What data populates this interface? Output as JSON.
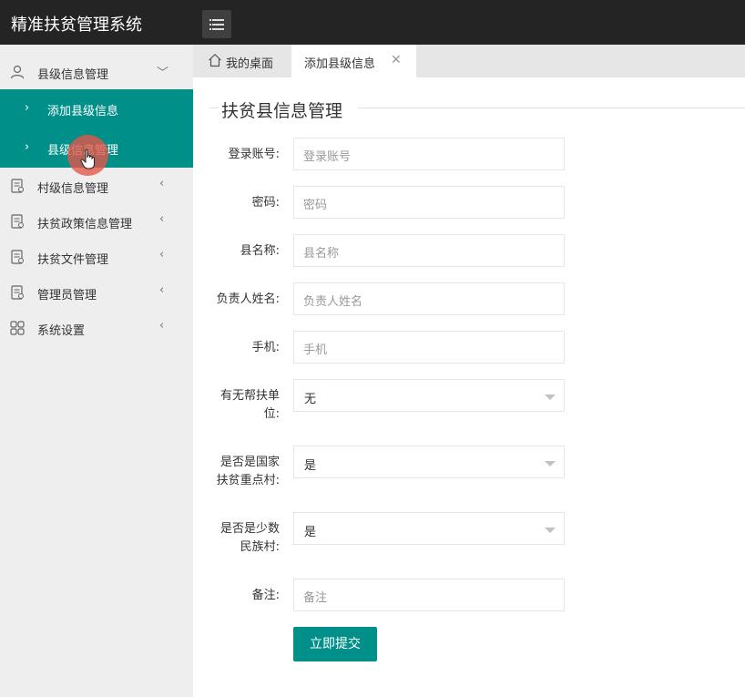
{
  "app": {
    "title": "精准扶贫管理系统"
  },
  "header": {
    "menu_icon": "menu-icon"
  },
  "sidebar": {
    "groups": [
      {
        "label": "县级信息管理",
        "icon": "user-icon",
        "expanded": true
      },
      {
        "label": "村级信息管理",
        "icon": "document-icon"
      },
      {
        "label": "扶贫政策信息管理",
        "icon": "document-icon"
      },
      {
        "label": "扶贫文件管理",
        "icon": "document-icon"
      },
      {
        "label": "管理员管理",
        "icon": "document-icon"
      },
      {
        "label": "系统设置",
        "icon": "grid-icon"
      }
    ],
    "sub_items": [
      {
        "label": "添加县级信息"
      },
      {
        "label": "县级信息管理"
      }
    ],
    "accent": "#009089"
  },
  "tabs": [
    {
      "label": "我的桌面",
      "icon": "home-icon"
    },
    {
      "label": "添加县级信息",
      "active": true
    }
  ],
  "form": {
    "legend": "扶贫县信息管理",
    "fields": [
      {
        "label": "登录账号:",
        "placeholder": "登录账号"
      },
      {
        "label": "密码:",
        "placeholder": "密码"
      },
      {
        "label": "县名称:",
        "placeholder": "县名称"
      },
      {
        "label": "负责人姓名:",
        "placeholder": "负责人姓名"
      },
      {
        "label": "手机:",
        "placeholder": "手机"
      },
      {
        "label_line1": "有无帮扶单",
        "label_line2": "位:",
        "value": "无"
      },
      {
        "label_line1": "是否是国家",
        "label_line2": "扶贫重点村:",
        "value": "是"
      },
      {
        "label_line1": "是否是少数",
        "label_line2": "民族村:",
        "value": "是"
      },
      {
        "label": "备注:",
        "placeholder": "备注"
      }
    ],
    "submit_label": "立即提交"
  }
}
